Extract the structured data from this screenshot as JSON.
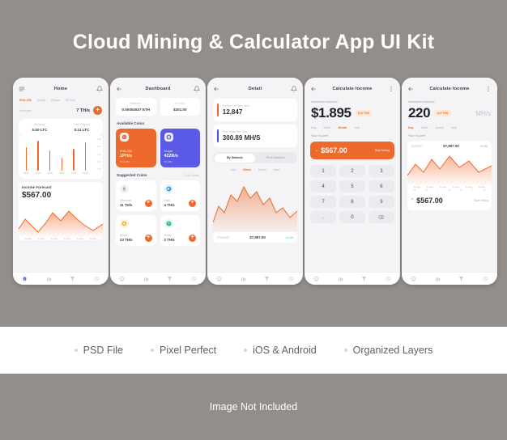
{
  "poster": {
    "title": "Cloud Mining & Calculator App UI Kit",
    "features": [
      "PSD File",
      "Pixel Perfect",
      "iOS & Android",
      "Organized Layers"
    ],
    "notice": "Image Not Included"
  },
  "screens": [
    {
      "header": {
        "title": "Home",
        "left_icon": "menu-icon",
        "right_icon": "bell-icon"
      },
      "algorithms": [
        "SHA-256",
        "Scrypt",
        "Ethash",
        "BTCAS"
      ],
      "hashrate": {
        "label": "Hashrate",
        "value": "7 TH/s",
        "add_label": "+"
      },
      "balances": [
        {
          "label": "Balance",
          "value": "0.00 LTC"
        },
        {
          "label": "Last Payout",
          "value": "0.12 LTC"
        }
      ],
      "bar_chart": {
        "values": [
          72,
          92,
          62,
          40,
          68,
          88
        ],
        "xticks": [
          "00:00",
          "01:00",
          "02:00",
          "03:00",
          "04:00",
          "05:00"
        ],
        "yticks": [
          "0.04",
          "0.03",
          "0.02",
          "0.01",
          "0.00"
        ]
      },
      "forecast": {
        "title": "Income Forecast",
        "amount": "$567.00"
      },
      "dates": [
        "10 Aug",
        "11 Aug",
        "12 Aug",
        "13 Aug",
        "14 Aug",
        "15 Aug"
      ],
      "nav": [
        "home-icon",
        "chart-icon",
        "funnel-icon",
        "clock-icon"
      ]
    },
    {
      "header": {
        "title": "Dashboard",
        "left_icon": "back-arrow-icon",
        "right_icon": "bell-icon"
      },
      "balances": [
        {
          "label": "Balance",
          "value": "0.00004537 ETH"
        },
        {
          "label": "In USD",
          "value": "$201.00"
        }
      ],
      "available": {
        "title": "Available Coins",
        "coins": [
          {
            "name": "SHA-256",
            "rate": "1PH/s",
            "usd": "521 USD",
            "icon": "sha-icon",
            "theme": "orange"
          },
          {
            "name": "Scrypt",
            "rate": "422R/s",
            "usd": "78 USD",
            "icon": "scrypt-icon",
            "theme": "blue"
          }
        ]
      },
      "suggested": {
        "title": "Suggested Coins",
        "period": "This Week",
        "coins": [
          {
            "name": "Ethereum",
            "rate": "11 TH/s",
            "icon": "ethereum-icon",
            "color": "#9aa0a6",
            "bg": "#f1f1f4"
          },
          {
            "name": "Dash",
            "rate": "4 TH/s",
            "icon": "dash-icon",
            "color": "#2e9ae0",
            "bg": "#e3f1fb"
          },
          {
            "name": "Bitcoin",
            "rate": "23 TH/s",
            "icon": "bitcoin-icon",
            "color": "#f0b429",
            "bg": "#fdf3dd"
          },
          {
            "name": "Tether",
            "rate": "2 TH/s",
            "icon": "tether-icon",
            "color": "#2ab37e",
            "bg": "#e1f5ec"
          }
        ],
        "add_label": "+"
      },
      "nav": [
        "home-icon",
        "chart-icon",
        "funnel-icon",
        "clock-icon"
      ]
    },
    {
      "header": {
        "title": "Detail",
        "left_icon": "back-arrow-icon",
        "right_icon": "bell-icon"
      },
      "stats": [
        {
          "label": "Income Of Past Year",
          "value": "12,847",
          "accent": "#ee6a2c"
        },
        {
          "label": "Pool Hashrate Now",
          "value": "300.89 MH/S",
          "accent": "#3b5bdb"
        }
      ],
      "toggle": {
        "options": [
          "My Statistic",
          "Pool Statistic"
        ],
        "active": "My Statistic"
      },
      "periods": [
        "Day",
        "Week",
        "Month",
        "Year"
      ],
      "active_period": "Week",
      "pair": {
        "name": "ETH/USDT",
        "value": "$7,987.00",
        "change": "+12.35"
      },
      "nav": [
        "home-icon",
        "chart-icon",
        "funnel-icon",
        "clock-icon"
      ]
    },
    {
      "header": {
        "title": "Calculate Income",
        "left_icon": "back-arrow-icon",
        "right_icon": "more-icon"
      },
      "investment": {
        "label": "Investment Amount",
        "amount": "$1.895",
        "badge": "12.8 TH/S"
      },
      "periods": [
        "Day",
        "Week",
        "Month",
        "Year"
      ],
      "active_period": "Month",
      "income": {
        "label": "Your Income",
        "amount": "$567.00",
        "cta": "Start Mining"
      },
      "keypad": [
        "1",
        "2",
        "3",
        "4",
        "5",
        "6",
        "7",
        "8",
        "9",
        ".",
        "0",
        "backspace-icon"
      ],
      "nav": [
        "home-icon",
        "chart-icon",
        "funnel-icon",
        "clock-icon"
      ]
    },
    {
      "header": {
        "title": "Calculate Income",
        "left_icon": "back-arrow-icon",
        "right_icon": "more-icon"
      },
      "investment": {
        "label": "Investment Amount",
        "amount": "220",
        "badge": "12.8 TH/S",
        "unit": "MH/s"
      },
      "periods": [
        "Day",
        "Week",
        "Month",
        "Year"
      ],
      "active_period": "Day",
      "income_label": "Your Income",
      "pair": {
        "name": "BTC/ETH",
        "value": "$7,987.00",
        "change": "+12.35"
      },
      "dates": [
        "10 Aug",
        "11 Aug",
        "12 Aug",
        "13 Aug",
        "14 Aug",
        "15 Aug"
      ],
      "weekdays": [
        "S",
        "M",
        "T",
        "W",
        "Th",
        "F",
        "St"
      ],
      "active_weekday": "S",
      "income": {
        "amount": "$567.00",
        "cta": "Start Mining"
      },
      "nav": [
        "home-icon",
        "chart-icon",
        "funnel-icon",
        "clock-icon"
      ]
    }
  ]
}
